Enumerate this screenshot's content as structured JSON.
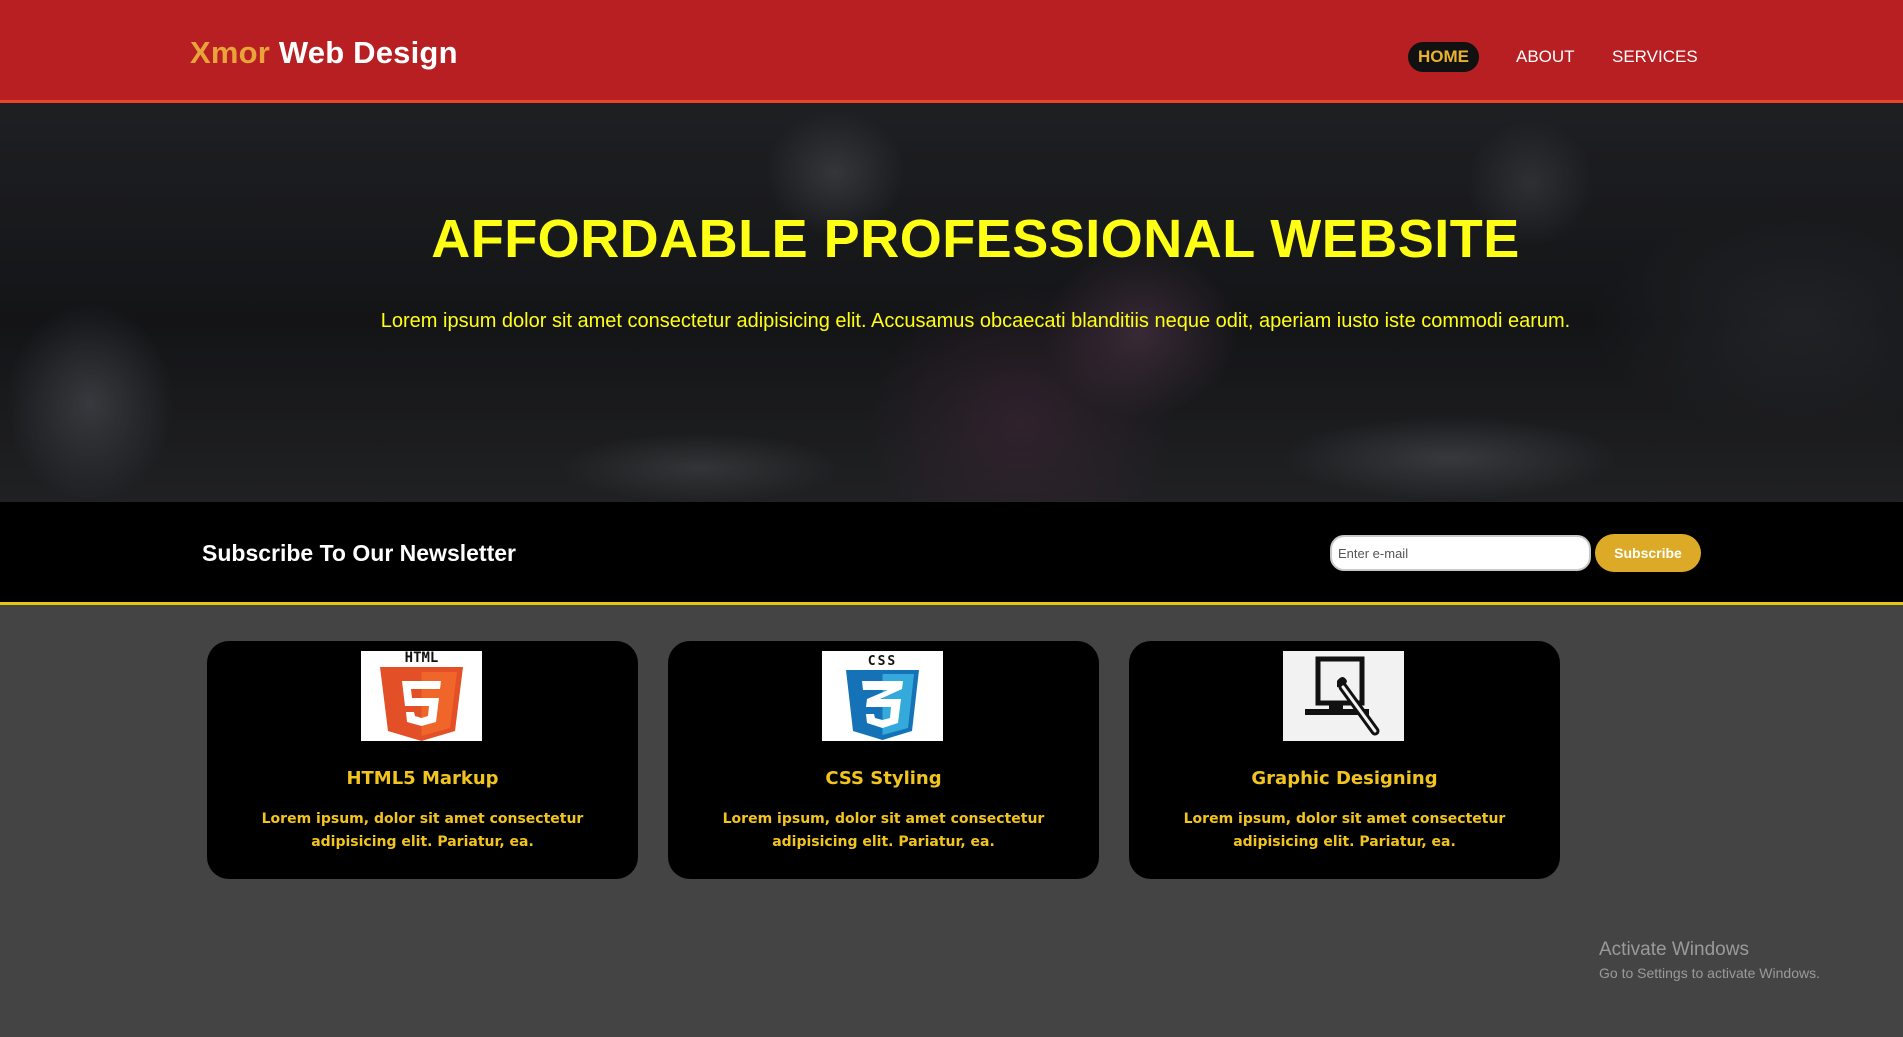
{
  "header": {
    "brand": "Xmor",
    "brand_rest": " Web Design",
    "nav": [
      {
        "label": "HOME",
        "active": true
      },
      {
        "label": "ABOUT",
        "active": false
      },
      {
        "label": "SERVICES",
        "active": false
      }
    ]
  },
  "hero": {
    "title": "AFFORDABLE PROFESSIONAL WEBSITE",
    "text": "Lorem ipsum dolor sit amet consectetur adipisicing elit. Accusamus obcaecati blanditiis neque odit, aperiam iusto iste commodi earum."
  },
  "newsletter": {
    "heading": "Subscribe To Our Newsletter",
    "email_placeholder": "Enter e-mail",
    "email_value": "",
    "button_label": "Subscribe"
  },
  "cards": [
    {
      "icon": "html5-icon",
      "icon_label": "HTML",
      "title": "HTML5 Markup",
      "text": "Lorem ipsum, dolor sit amet consectetur adipisicing elit. Pariatur, ea."
    },
    {
      "icon": "css3-icon",
      "icon_label": "CSS",
      "title": "CSS Styling",
      "text": "Lorem ipsum, dolor sit amet consectetur adipisicing elit. Pariatur, ea."
    },
    {
      "icon": "graphic-design-icon",
      "title": "Graphic Designing",
      "text": "Lorem ipsum, dolor sit amet consectetur adipisicing elit. Pariatur, ea."
    }
  ],
  "watermark": {
    "title": "Activate Windows",
    "subtitle": "Go to Settings to activate Windows."
  },
  "colors": {
    "header_bg": "#b71f22",
    "brand_accent": "#e8a33a",
    "hero_text": "#ffff15",
    "card_text": "#f2c41e",
    "subscribe_button": "#dcaa26",
    "page_bg": "#444444"
  }
}
